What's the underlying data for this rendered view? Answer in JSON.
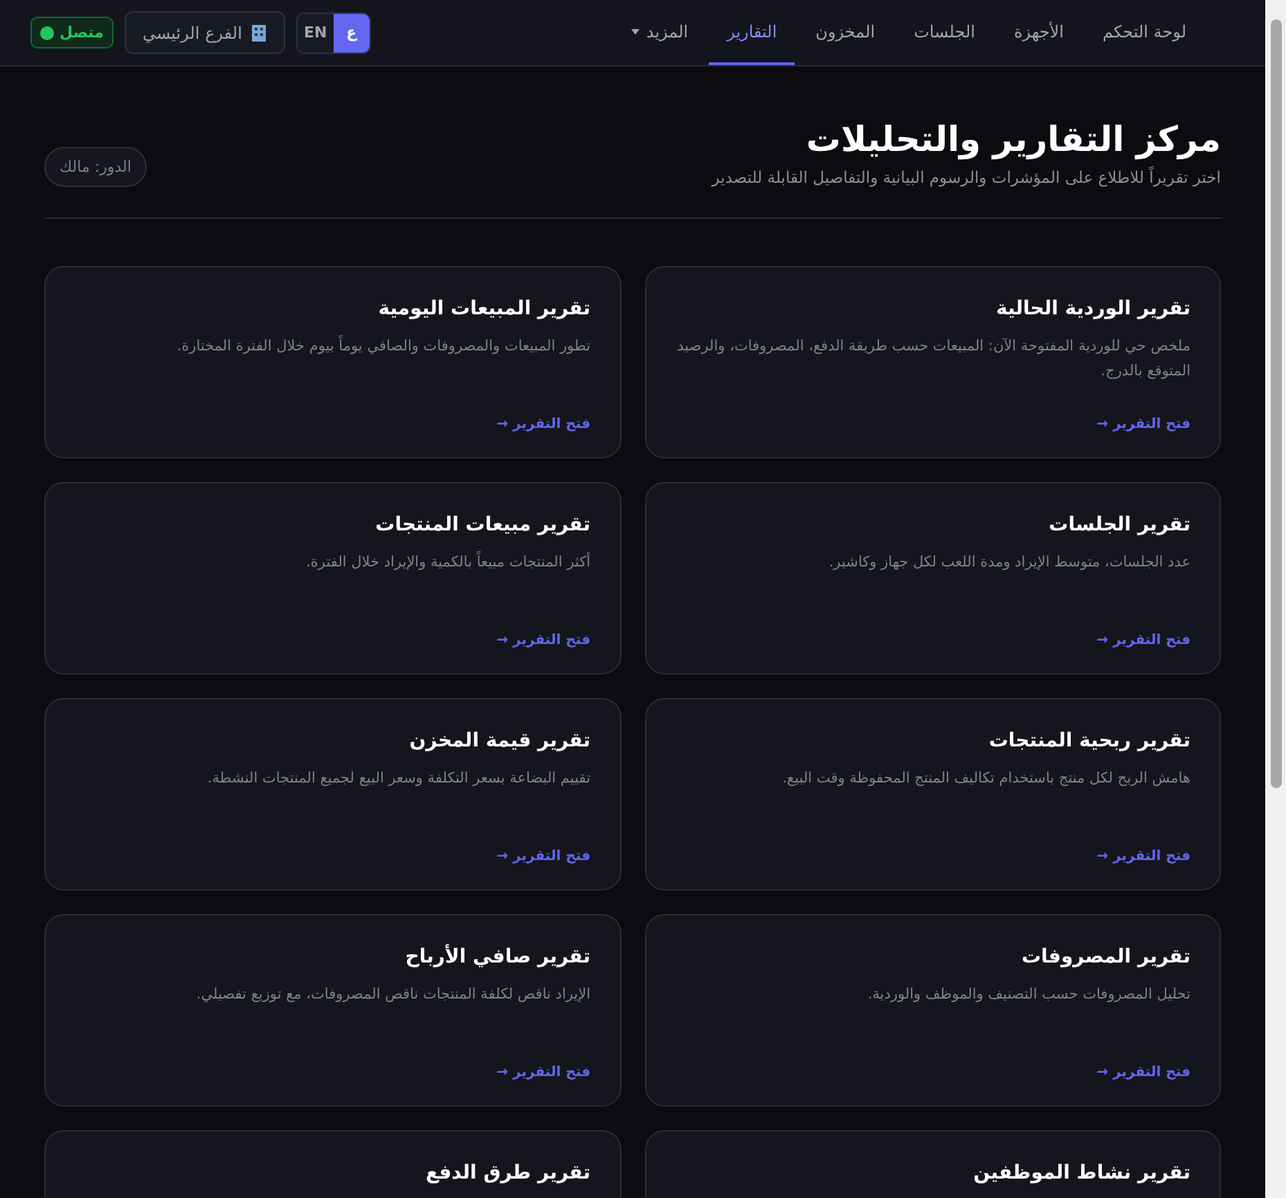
{
  "nav": {
    "tabs": [
      {
        "label": "لوحة التحكم",
        "selected": false
      },
      {
        "label": "الأجهزة",
        "selected": false
      },
      {
        "label": "الجلسات",
        "selected": false
      },
      {
        "label": "المخزون",
        "selected": false
      },
      {
        "label": "التقارير",
        "selected": true
      },
      {
        "label": "المزيد",
        "selected": false,
        "kind": "dropdown"
      }
    ],
    "languages": [
      {
        "label": "ع",
        "selected": true
      },
      {
        "label": "EN",
        "selected": false
      }
    ],
    "branch": "الفرع الرئيسي",
    "status": {
      "label": "متصل",
      "color": "#22c55e"
    }
  },
  "header": {
    "title": "مركز التقارير والتحليلات",
    "subtitle": "اختر تقريراً للاطلاع على المؤشرات والرسوم البيانية والتفاصيل القابلة للتصدير",
    "role": "الدور: مالك"
  },
  "reports": [
    {
      "title": "تقرير الوردية الحالية",
      "description": "ملخص حي للوردية المفتوحة الآن: المبيعات حسب طريقة الدفع، المصروفات، والرصيد المتوقع بالدرج.",
      "link": "فتح التقرير →"
    },
    {
      "title": "تقرير المبيعات اليومية",
      "description": "تطور المبيعات والمصروفات والصافي يوماً بيوم خلال الفترة المختارة.",
      "link": "فتح التقرير →"
    },
    {
      "title": "تقرير الجلسات",
      "description": "عدد الجلسات، متوسط الإيراد ومدة اللعب لكل جهاز وكاشير.",
      "link": "فتح التقرير →"
    },
    {
      "title": "تقرير مبيعات المنتجات",
      "description": "أكثر المنتجات مبيعاً بالكمية والإيراد خلال الفترة.",
      "link": "فتح التقرير →"
    },
    {
      "title": "تقرير ربحية المنتجات",
      "description": "هامش الربح لكل منتج باستخدام تكاليف المنتج المحفوظة وقت البيع.",
      "link": "فتح التقرير →"
    },
    {
      "title": "تقرير قيمة المخزن",
      "description": "تقييم البضاعة بسعر التكلفة وسعر البيع لجميع المنتجات النشطة.",
      "link": "فتح التقرير →"
    },
    {
      "title": "تقرير المصروفات",
      "description": "تحليل المصروفات حسب التصنيف والموظف والوردية.",
      "link": "فتح التقرير →"
    },
    {
      "title": "تقرير صافي الأرباح",
      "description": "الإيراد ناقص لكلفة المنتجات ناقص المصروفات، مع توزيع تفصيلي.",
      "link": "فتح التقرير →"
    },
    {
      "title": "تقرير نشاط الموظفين"
    },
    {
      "title": "تقرير طرق الدفع"
    }
  ]
}
